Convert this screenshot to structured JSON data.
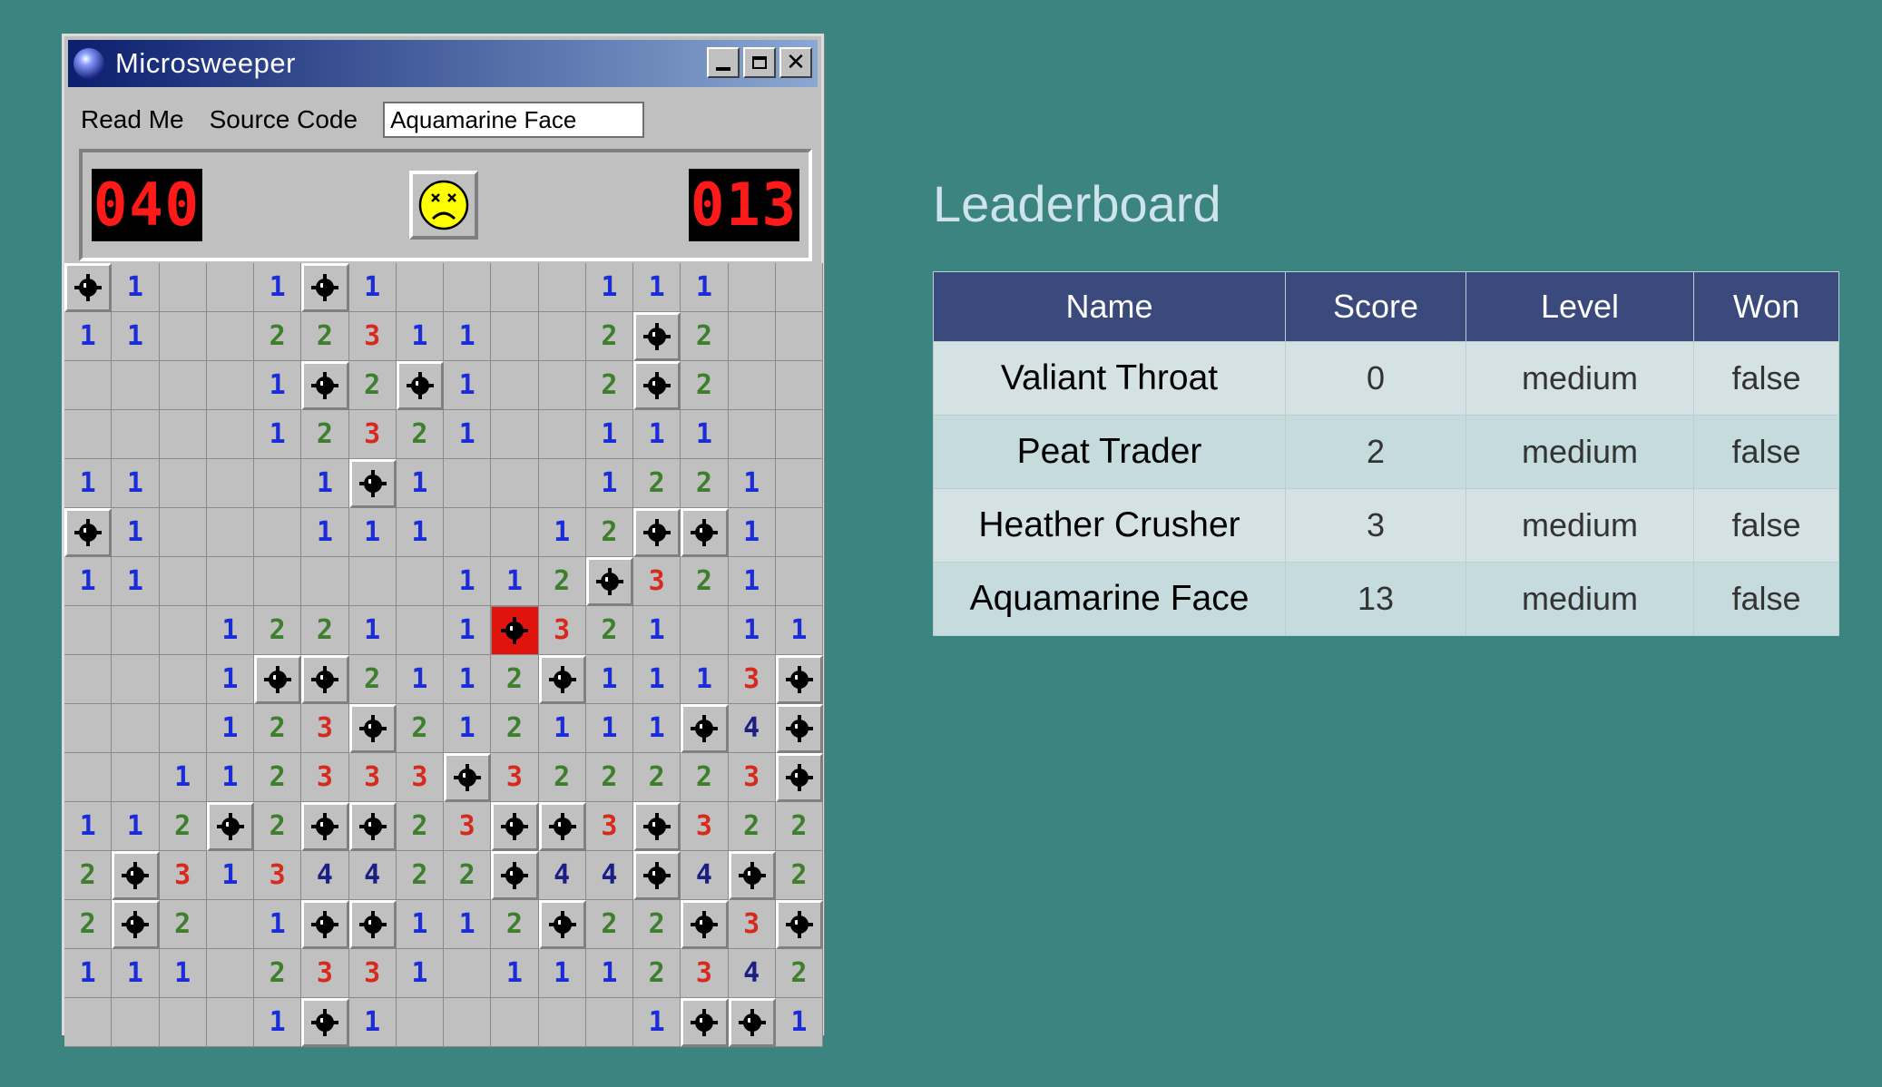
{
  "window": {
    "title": "Microsweeper",
    "controls": [
      "minimize",
      "maximize",
      "close"
    ],
    "close_glyph": "✕"
  },
  "menu": {
    "read_me": "Read Me",
    "source_code": "Source Code",
    "name_input_value": "Aquamarine Face"
  },
  "game": {
    "mine_counter": "040",
    "timer": "013",
    "face_state": "dead",
    "board": [
      "M1..1M1....111..",
      "11..22311..2M2..",
      "....1M2M1..2M2..",
      "....12321..111..",
      "11...1M1...1221.",
      "M1...111..12MM1.",
      "11.......112M321.",
      "...1221.1X321.11",
      "...1MM2112M1113M",
      "...123M21211 1M4M",
      "..11233M3M322223M",
      "112M2MM23MM3M322",
      "2M3134422M44M4M2",
      "2M2.1MM112M22M3M",
      "111.2331.111234 2",
      "....1M1.....1MM1"
    ],
    "board_rows": [
      [
        "M",
        "1",
        "",
        "",
        "1",
        "M",
        "1",
        "",
        "",
        "",
        "",
        "1",
        "1",
        "1",
        "",
        ""
      ],
      [
        "1",
        "1",
        "",
        "",
        "2",
        "2",
        "3",
        "1",
        "1",
        "",
        "",
        "2",
        "M",
        "2",
        "",
        ""
      ],
      [
        "",
        "",
        "",
        "",
        "1",
        "M",
        "2",
        "M",
        "1",
        "",
        "",
        "2",
        "M",
        "2",
        "",
        ""
      ],
      [
        "",
        "",
        "",
        "",
        "1",
        "2",
        "3",
        "2",
        "1",
        "",
        "",
        "1",
        "1",
        "1",
        "",
        ""
      ],
      [
        "1",
        "1",
        "",
        "",
        "",
        "1",
        "M",
        "1",
        "",
        "",
        "",
        "1",
        "2",
        "2",
        "1",
        ""
      ],
      [
        "M",
        "1",
        "",
        "",
        "",
        "1",
        "1",
        "1",
        "",
        "",
        "1",
        "2",
        "M",
        "M",
        "1",
        ""
      ],
      [
        "1",
        "1",
        "",
        "",
        "",
        "",
        "",
        "",
        "1",
        "1",
        "2",
        "M",
        "3",
        "2",
        "1",
        ""
      ],
      [
        "",
        "",
        "",
        "1",
        "2",
        "2",
        "1",
        "",
        "1",
        "X",
        "3",
        "2",
        "1",
        "",
        "1",
        "1"
      ],
      [
        "",
        "",
        "",
        "1",
        "M",
        "M",
        "2",
        "1",
        "1",
        "2",
        "M",
        "1",
        "1",
        "1",
        "3",
        "M"
      ],
      [
        "",
        "",
        "",
        "1",
        "2",
        "3",
        "M",
        "2",
        "1",
        "2",
        "1",
        "1",
        "1",
        "M",
        "4",
        "M"
      ],
      [
        "",
        "",
        "1",
        "1",
        "2",
        "3",
        "3",
        "3",
        "M",
        "3",
        "2",
        "2",
        "2",
        "2",
        "3",
        "M"
      ],
      [
        "1",
        "1",
        "2",
        "M",
        "2",
        "M",
        "M",
        "2",
        "3",
        "M",
        "M",
        "3",
        "M",
        "3",
        "2",
        "2"
      ],
      [
        "2",
        "M",
        "3",
        "1",
        "3",
        "4",
        "4",
        "2",
        "2",
        "M",
        "4",
        "4",
        "M",
        "4",
        "M",
        "2"
      ],
      [
        "2",
        "M",
        "2",
        "",
        "1",
        "M",
        "M",
        "1",
        "1",
        "2",
        "M",
        "2",
        "2",
        "M",
        "3",
        "M"
      ],
      [
        "1",
        "1",
        "1",
        "",
        "2",
        "3",
        "3",
        "1",
        "",
        "1",
        "1",
        "1",
        "2",
        "3",
        "4",
        "2"
      ],
      [
        "",
        "",
        "",
        "",
        "1",
        "M",
        "1",
        "",
        "",
        "",
        "",
        "",
        "1",
        "M",
        "M",
        "1"
      ]
    ]
  },
  "leaderboard": {
    "title": "Leaderboard",
    "headers": [
      "Name",
      "Score",
      "Level",
      "Won"
    ],
    "rows": [
      {
        "name": "Valiant Throat",
        "score": "0",
        "level": "medium",
        "won": "false"
      },
      {
        "name": "Peat Trader",
        "score": "2",
        "level": "medium",
        "won": "false"
      },
      {
        "name": "Heather Crusher",
        "score": "3",
        "level": "medium",
        "won": "false"
      },
      {
        "name": "Aquamarine Face",
        "score": "13",
        "level": "medium",
        "won": "false"
      }
    ]
  },
  "colors": {
    "background": "#3b8480",
    "number_1": "#1a2cd8",
    "number_2": "#3e7f2e",
    "number_3": "#d62a1e",
    "number_4": "#1b1f84",
    "exploded_mine": "#e0140c",
    "table_header": "#3a4a7c"
  }
}
